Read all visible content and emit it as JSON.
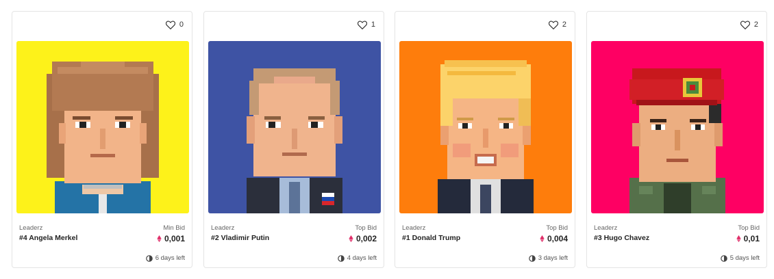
{
  "cards": [
    {
      "likes": "0",
      "collection": "Leaderz",
      "title": "#4 Angela Merkel",
      "bid_label": "Min Bid",
      "price": "0,001",
      "time_left": "6 days left",
      "bg": "#fdf21a",
      "character": "merkel"
    },
    {
      "likes": "1",
      "collection": "Leaderz",
      "title": "#2 Vladimir Putin",
      "bid_label": "Top Bid",
      "price": "0,002",
      "time_left": "4 days left",
      "bg": "#3e53a4",
      "character": "putin"
    },
    {
      "likes": "2",
      "collection": "Leaderz",
      "title": "#1 Donald Trump",
      "bid_label": "Top Bid",
      "price": "0,004",
      "time_left": "3 days left",
      "bg": "#fe7d0c",
      "character": "trump"
    },
    {
      "likes": "2",
      "collection": "Leaderz",
      "title": "#3 Hugo Chavez",
      "bid_label": "Top Bid",
      "price": "0,01",
      "time_left": "5 days left",
      "bg": "#fe0063",
      "character": "chavez"
    }
  ],
  "icons": {
    "like": "heart-icon",
    "currency": "ethereum-icon",
    "timer": "clock-icon"
  },
  "colors": {
    "eth_accent": "#e0306a"
  }
}
